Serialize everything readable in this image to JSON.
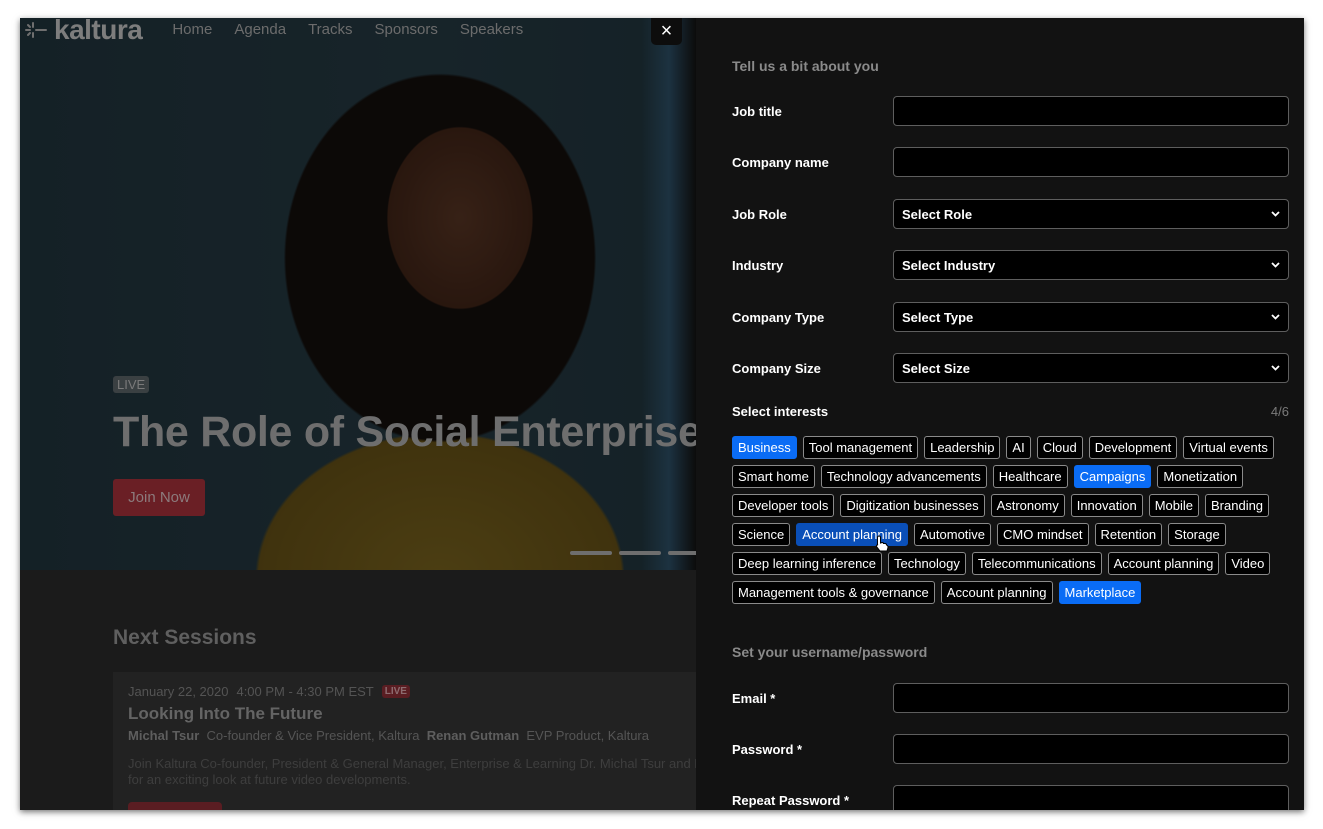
{
  "background_page": {
    "logo_text": "kaltura",
    "nav": [
      "Home",
      "Agenda",
      "Tracks",
      "Sponsors",
      "Speakers"
    ],
    "hero": {
      "live_label": "LIVE",
      "title": "The Role of Social Enterprise",
      "cta": "Join Now",
      "carousel_slides": 3
    },
    "next_sessions": {
      "title": "Next Sessions",
      "session": {
        "date": "January 22, 2020",
        "time": "4:00 PM - 4:30 PM EST",
        "live_label": "LIVE",
        "title": "Looking Into The Future",
        "speakers": [
          {
            "name": "Michal Tsur",
            "role": "Co-founder & Vice President, Kaltura"
          },
          {
            "name": "Renan Gutman",
            "role": "EVP Product, Kaltura"
          }
        ],
        "description": "Join Kaltura Co-founder, President & General Manager, Enterprise & Learning Dr. Michal Tsur and Hea for an exciting look at future video developments."
      }
    }
  },
  "drawer": {
    "close_label": "×",
    "about_section_title": "Tell us a bit about you",
    "fields": {
      "job_title": {
        "label": "Job title",
        "value": ""
      },
      "company_name": {
        "label": "Company name",
        "value": ""
      },
      "job_role": {
        "label": "Job Role",
        "selected": "Select Role"
      },
      "industry": {
        "label": "Industry",
        "selected": "Select Industry"
      },
      "company_type": {
        "label": "Company Type",
        "selected": "Select Type"
      },
      "company_size": {
        "label": "Company Size",
        "selected": "Select Size"
      }
    },
    "interests": {
      "label": "Select interests",
      "count": "4/6",
      "items": [
        {
          "label": "Business",
          "state": "selected"
        },
        {
          "label": "Tool management",
          "state": "none"
        },
        {
          "label": "Leadership",
          "state": "none"
        },
        {
          "label": "AI",
          "state": "none"
        },
        {
          "label": "Cloud",
          "state": "none"
        },
        {
          "label": "Development",
          "state": "none"
        },
        {
          "label": "Virtual events",
          "state": "none"
        },
        {
          "label": "Smart home",
          "state": "none"
        },
        {
          "label": "Technology advancements",
          "state": "none"
        },
        {
          "label": "Healthcare",
          "state": "none"
        },
        {
          "label": "Campaigns",
          "state": "selected"
        },
        {
          "label": "Monetization",
          "state": "none"
        },
        {
          "label": "Developer tools",
          "state": "none"
        },
        {
          "label": "Digitization  businesses",
          "state": "none"
        },
        {
          "label": "Astronomy",
          "state": "none"
        },
        {
          "label": "Innovation",
          "state": "none"
        },
        {
          "label": "Mobile",
          "state": "none"
        },
        {
          "label": "Branding",
          "state": "none"
        },
        {
          "label": "Science",
          "state": "none"
        },
        {
          "label": "Account planning",
          "state": "hover"
        },
        {
          "label": "Automotive",
          "state": "none"
        },
        {
          "label": "CMO mindset",
          "state": "none"
        },
        {
          "label": "Retention",
          "state": "none"
        },
        {
          "label": "Storage",
          "state": "none"
        },
        {
          "label": "Deep learning inference",
          "state": "none"
        },
        {
          "label": "Technology",
          "state": "none"
        },
        {
          "label": "Telecommunications",
          "state": "none"
        },
        {
          "label": "Account planning",
          "state": "none"
        },
        {
          "label": "Video",
          "state": "none"
        },
        {
          "label": "Management tools & governance",
          "state": "none"
        },
        {
          "label": "Account planning",
          "state": "none"
        },
        {
          "label": "Marketplace",
          "state": "selected"
        }
      ]
    },
    "credentials_section_title": "Set your username/password",
    "credentials": {
      "email": {
        "label": "Email *",
        "value": ""
      },
      "password": {
        "label": "Password *",
        "value": ""
      },
      "repeat_password": {
        "label": "Repeat Password *",
        "value": ""
      }
    }
  },
  "colors": {
    "selected_chip": "#0a6cf5",
    "hover_chip": "#0a4fb8",
    "drawer_bg": "#121212",
    "accent_red": "#8b1e2a"
  }
}
